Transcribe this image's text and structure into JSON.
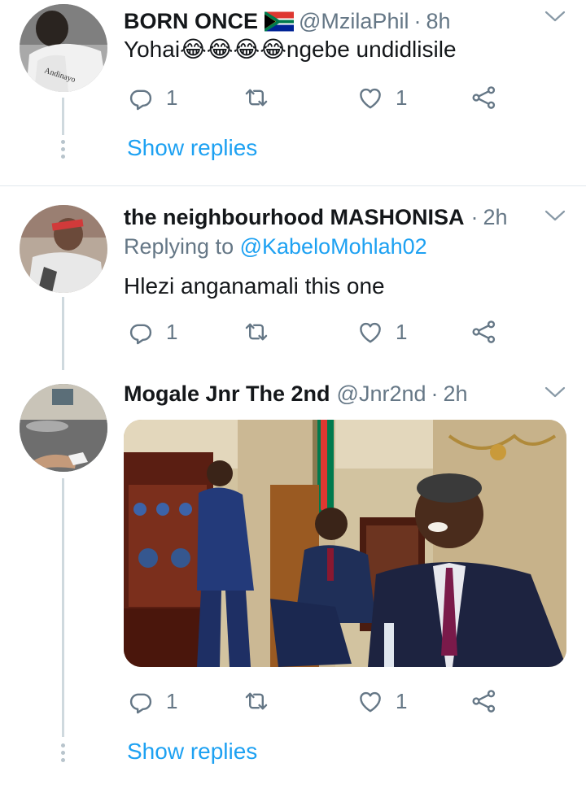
{
  "tweets": [
    {
      "name": "BORN ONCE",
      "handle": "@MzilaPhil",
      "sep": "·",
      "time": "8h",
      "flag_icon": "south-africa-flag-icon",
      "text": "Yohai😂😂😂😂ngebe undidlisile",
      "avatar_text": "Andinayo",
      "reply_count": "1",
      "like_count": "1",
      "show_replies": "Show replies"
    },
    {
      "name": "the neighbourhood MASHONISA",
      "sep": "·",
      "time": "2h",
      "replying_prefix": "Replying to",
      "replying_handle": "@KabeloMohlah02",
      "text": "Hlezi anganamali this one",
      "reply_count": "1",
      "like_count": "1"
    },
    {
      "name": "Mogale Jnr The 2nd",
      "handle": "@Jnr2nd",
      "sep": "·",
      "time": "2h",
      "reply_count": "1",
      "like_count": "1",
      "show_replies": "Show replies"
    }
  ],
  "icons": {
    "reply": "reply-icon",
    "retweet": "retweet-icon",
    "like": "heart-icon",
    "share": "share-icon",
    "more": "chevron-down-icon"
  },
  "colors": {
    "link": "#1da1f2",
    "muted": "#657786",
    "thread_line": "#cfd9de"
  }
}
